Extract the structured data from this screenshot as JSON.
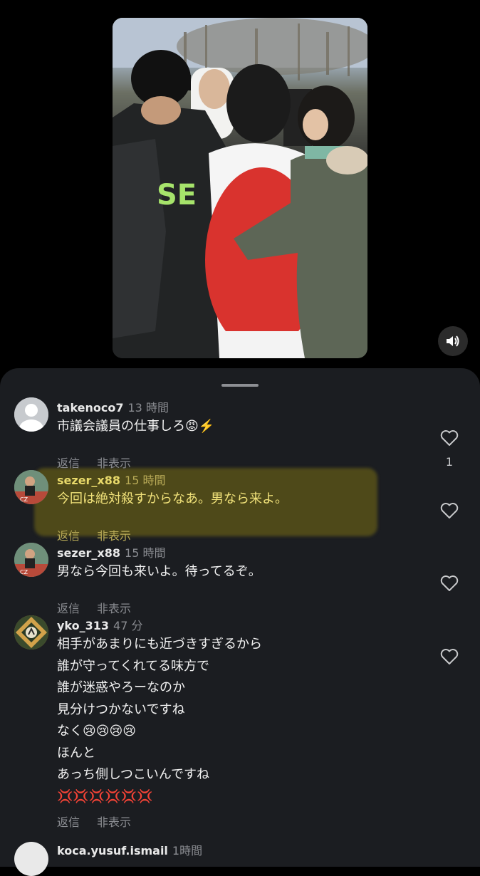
{
  "comments": [
    {
      "username": "takenoco7",
      "time": "13 時間",
      "text": [
        "市議会議員の仕事しろ😡⚡️"
      ],
      "reply": "返信",
      "hide": "非表示",
      "likes": "1"
    },
    {
      "username": "sezer_x88",
      "time": "15 時間",
      "text": [
        "今回は絶対殺すからなあ。男なら来よ。"
      ],
      "reply": "返信",
      "hide": "非表示",
      "likes": ""
    },
    {
      "username": "sezer_x88",
      "time": "15 時間",
      "text": [
        "男なら今回も来いよ。待ってるぞ。"
      ],
      "reply": "返信",
      "hide": "非表示",
      "likes": ""
    },
    {
      "username": "yko_313",
      "time": "47 分",
      "text": [
        "相手があまりにも近づきすぎるから",
        "誰が守ってくれてる味方で",
        "誰が迷惑やろーなのか",
        "見分けつかないですね",
        "なく😢😢😢😢",
        "ほんと",
        "あっち側しつこいんですね",
        "💢💢💢💢💢💢"
      ],
      "reply": "返信",
      "hide": "非表示",
      "likes": ""
    },
    {
      "username": "koca.yusuf.ismail",
      "time": "1時間"
    }
  ],
  "colors": {
    "sheet": "#1b1d21",
    "highlight": "#786e14"
  }
}
